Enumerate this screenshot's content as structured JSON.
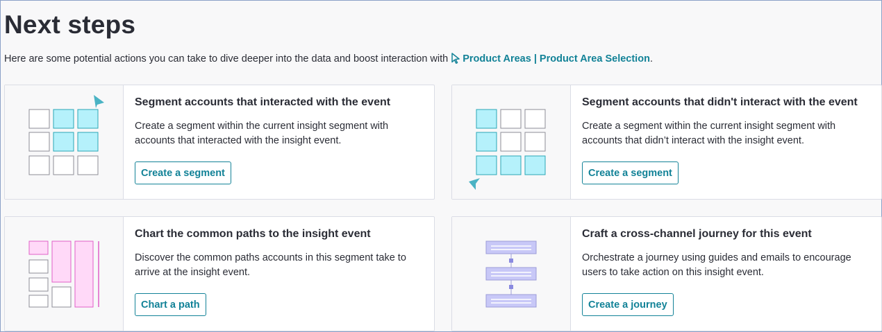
{
  "page": {
    "title": "Next steps",
    "intro_text": "Here are some potential actions you can take to dive deeper into the data and boost interaction with ",
    "intro_link": "Product Areas | Product Area Selection",
    "intro_end": ".",
    "link_icon": "cursor-icon"
  },
  "colors": {
    "accent": "#128297",
    "cyan_fill": "#b5f1fb",
    "pink_fill": "#ffd9f8",
    "purple_fill": "#c8c8f7"
  },
  "cards": [
    {
      "title": "Segment accounts that interacted with the event",
      "description": "Create a segment within the current insight segment with accounts that interacted with the insight event.",
      "button": "Create a segment",
      "icon": "grid-interacted-icon"
    },
    {
      "title": "Segment accounts that didn't interact with the event",
      "description": "Create a segment within the current insight segment with accounts that didn’t interact with the insight event.",
      "button": "Create a segment",
      "icon": "grid-not-interacted-icon"
    },
    {
      "title": "Chart the common paths to the insight event",
      "description": "Discover the common paths accounts in this segment take to arrive at the insight event.",
      "button": "Chart a path",
      "icon": "paths-icon"
    },
    {
      "title": "Craft a cross-channel journey for this event",
      "description": "Orchestrate a journey using guides and emails to encourage users to take action on this insight event.",
      "button": "Create a journey",
      "icon": "journey-icon"
    }
  ]
}
